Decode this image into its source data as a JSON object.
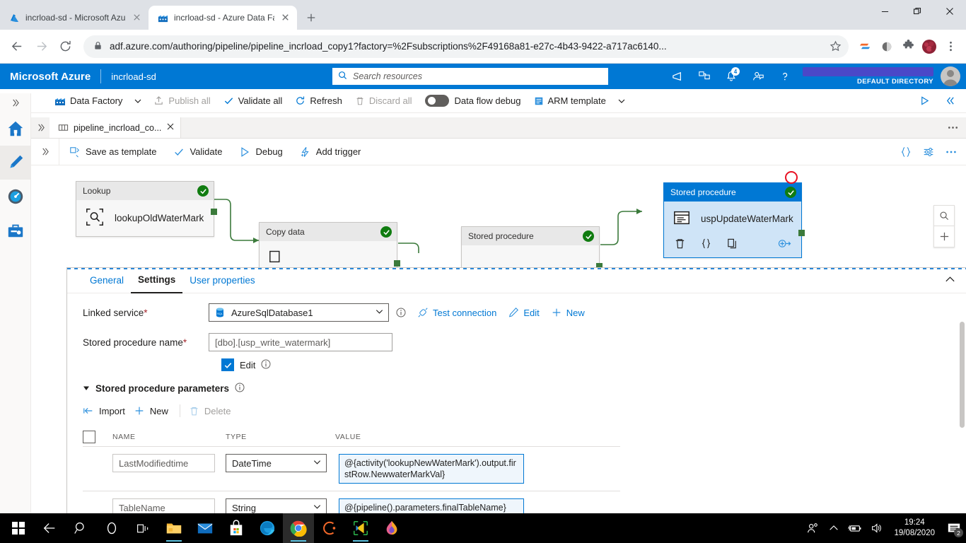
{
  "browser": {
    "tabs": [
      {
        "title": "incrload-sd - Microsoft Azure",
        "favicon": "azure-icon",
        "active": false
      },
      {
        "title": "incrload-sd - Azure Data Facto",
        "favicon": "data-factory-icon",
        "active": true
      }
    ],
    "url": "adf.azure.com/authoring/pipeline/pipeline_incrload_copy1?factory=%2Fsubscriptions%2F49168a81-e27c-4b43-9422-a717ac6140...",
    "new_tab_label": "+",
    "window": {
      "minimize": "minimize",
      "maximize": "restore",
      "close": "close"
    }
  },
  "azure_header": {
    "brand": "Microsoft Azure",
    "resource": "incrload-sd",
    "search_placeholder": "Search resources",
    "notification_count": "4",
    "directory": "DEFAULT DIRECTORY",
    "account_redacted": true
  },
  "adf_toolbar": {
    "data_factory": "Data Factory",
    "publish_all": "Publish all",
    "validate_all": "Validate all",
    "refresh": "Refresh",
    "discard_all": "Discard all",
    "data_flow_debug": "Data flow debug",
    "data_flow_debug_on": false,
    "arm_template": "ARM template"
  },
  "rail": {
    "items": [
      {
        "name": "home",
        "icon": "home-icon",
        "active": false
      },
      {
        "name": "author",
        "icon": "pencil-icon",
        "active": true
      },
      {
        "name": "monitor",
        "icon": "monitor-icon",
        "active": false
      },
      {
        "name": "manage",
        "icon": "toolbox-icon",
        "active": false
      }
    ]
  },
  "pipeline_tab": {
    "label": "pipeline_incrload_co...",
    "icon": "pipeline-icon"
  },
  "canvas_toolbar": {
    "save_as_template": "Save as template",
    "validate": "Validate",
    "debug": "Debug",
    "add_trigger": "Add trigger",
    "code_icon": "code-braces-icon",
    "properties_icon": "sliders-icon",
    "more_icon": "ellipsis-icon"
  },
  "canvas": {
    "zoom_to_fit": "search-icon",
    "zoom_in": "plus-icon",
    "activities": [
      {
        "type": "Lookup",
        "name": "lookupOldWaterMark",
        "icon": "lookup-icon",
        "status": "valid",
        "selected": false
      },
      {
        "type": "Copy data",
        "name": "",
        "icon": "copy-data-icon",
        "status": "valid",
        "selected": false
      },
      {
        "type": "Stored procedure",
        "name": "",
        "icon": "stored-procedure-icon",
        "status": "valid",
        "selected": false
      },
      {
        "type": "Stored procedure",
        "name": "uspUpdateWaterMark",
        "icon": "stored-procedure-icon",
        "status": "valid",
        "selected": true
      }
    ],
    "selected_actions": [
      {
        "name": "delete",
        "icon": "trash-icon"
      },
      {
        "name": "code",
        "icon": "code-braces-icon"
      },
      {
        "name": "clone",
        "icon": "copy-icon"
      },
      {
        "name": "add-output",
        "icon": "add-output-icon"
      }
    ]
  },
  "properties": {
    "tabs": [
      {
        "label": "General",
        "active": false
      },
      {
        "label": "Settings",
        "active": true
      },
      {
        "label": "User properties",
        "active": false
      }
    ],
    "collapse_icon": "chevron-up-icon",
    "linked_service": {
      "label": "Linked service",
      "required": "*",
      "value": "AzureSqlDatabase1",
      "icon": "sql-database-icon",
      "info_icon": "info-icon",
      "actions": [
        {
          "label": "Test connection",
          "icon": "plug-icon"
        },
        {
          "label": "Edit",
          "icon": "pencil-icon"
        },
        {
          "label": "New",
          "icon": "plus-icon"
        }
      ]
    },
    "stored_procedure_name": {
      "label": "Stored procedure name",
      "required": "*",
      "value": "[dbo].[usp_write_watermark]"
    },
    "edit_checkbox": {
      "label": "Edit",
      "checked": true,
      "info_icon": "info-icon"
    },
    "parameters_section": {
      "title": "Stored procedure parameters",
      "info_icon": "info-icon",
      "collapse_icon": "triangle-down-icon",
      "toolbar": [
        {
          "label": "Import",
          "icon": "import-icon",
          "disabled": false
        },
        {
          "label": "New",
          "icon": "plus-icon",
          "disabled": false
        },
        {
          "label": "Delete",
          "icon": "trash-icon",
          "disabled": true
        }
      ],
      "columns": [
        "NAME",
        "TYPE",
        "VALUE"
      ],
      "rows": [
        {
          "name": "LastModifiedtime",
          "type": "DateTime",
          "value": "@{activity('lookupNewWaterMark').output.firstRow.NewwaterMarkVal}"
        },
        {
          "name": "TableName",
          "type": "String",
          "value": "@{pipeline().parameters.finalTableName}"
        }
      ]
    }
  },
  "taskbar": {
    "start": "start-icon",
    "items": [
      {
        "name": "back-arrow",
        "icon": "back-icon",
        "running": false
      },
      {
        "name": "search",
        "icon": "search-icon",
        "running": false
      },
      {
        "name": "cortana",
        "icon": "cortana-icon",
        "running": false
      },
      {
        "name": "task-view",
        "icon": "task-view-icon",
        "running": false
      },
      {
        "name": "file-explorer",
        "icon": "folder-icon",
        "running": true
      },
      {
        "name": "mail",
        "icon": "mail-icon",
        "running": false
      },
      {
        "name": "microsoft-store",
        "icon": "store-icon",
        "running": false
      },
      {
        "name": "microsoft-edge",
        "icon": "edge-icon",
        "running": false
      },
      {
        "name": "google-chrome",
        "icon": "chrome-icon",
        "running": true
      },
      {
        "name": "app-orange",
        "icon": "orange-arc-icon",
        "running": false
      },
      {
        "name": "visual-studio-code",
        "icon": "vscode-icon",
        "running": true
      },
      {
        "name": "app-gradient",
        "icon": "droplet-icon",
        "running": false
      }
    ],
    "tray": [
      {
        "name": "people",
        "icon": "people-icon"
      },
      {
        "name": "show-hidden-icons",
        "icon": "chevron-up-icon"
      },
      {
        "name": "battery",
        "icon": "battery-icon"
      },
      {
        "name": "volume",
        "icon": "speaker-icon"
      }
    ],
    "clock": {
      "time": "19:24",
      "date": "19/08/2020"
    },
    "notifications": {
      "count": "2",
      "icon": "action-center-icon"
    }
  }
}
